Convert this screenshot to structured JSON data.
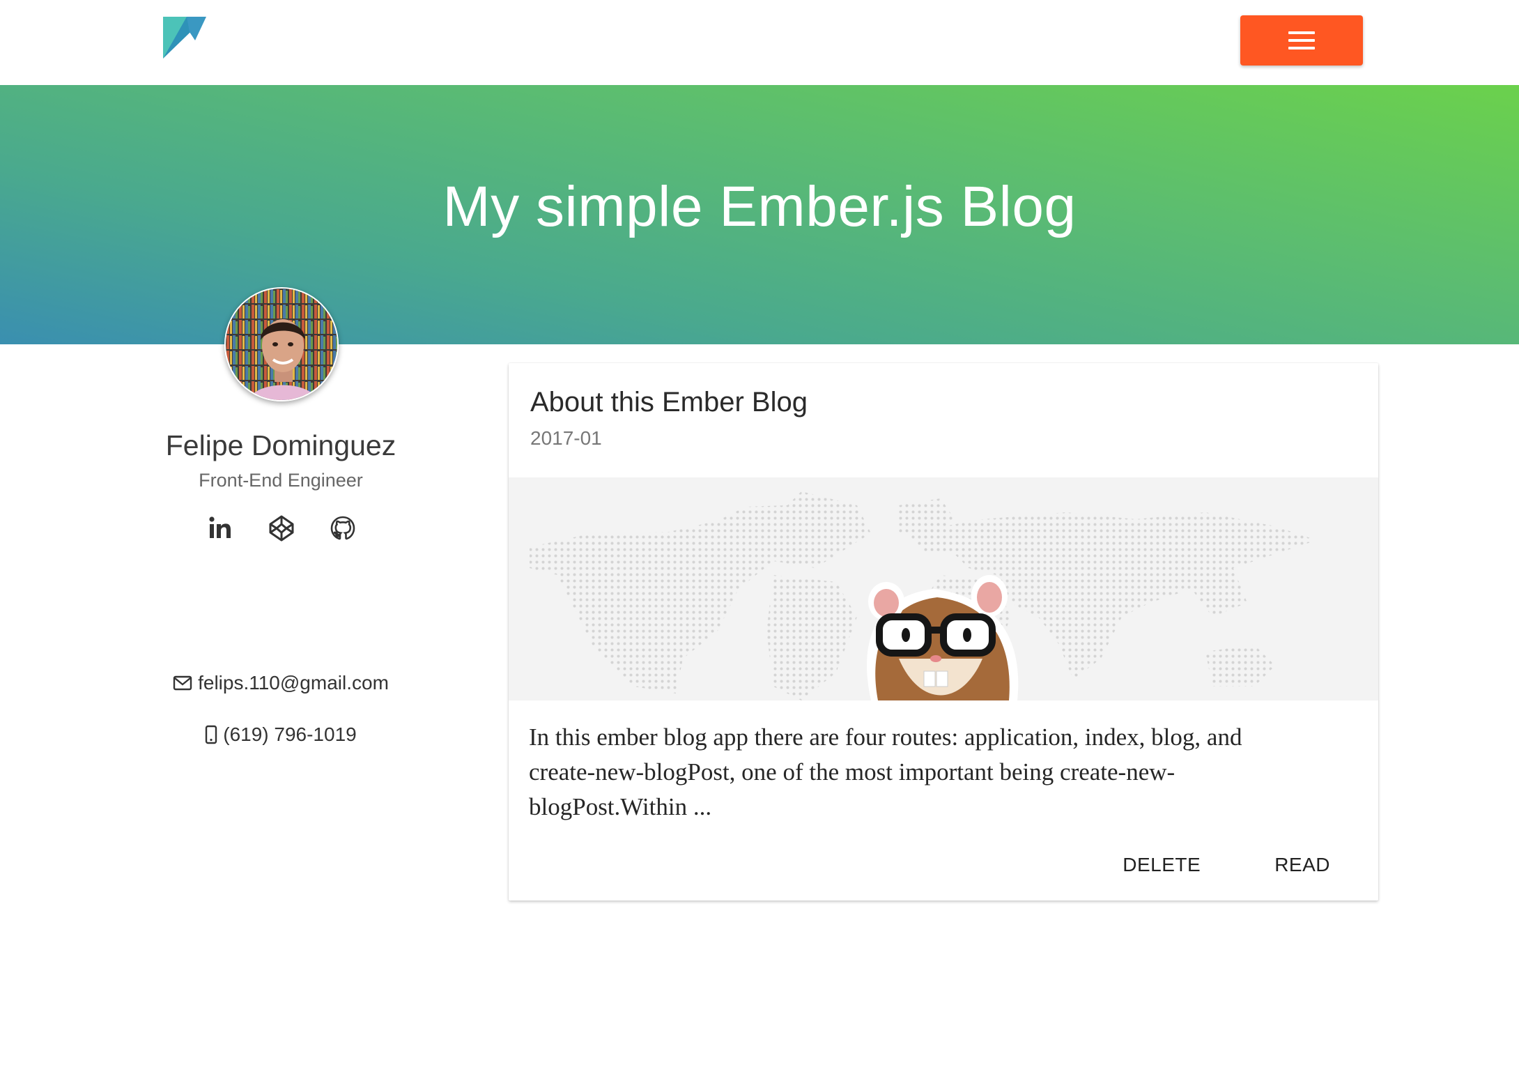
{
  "header": {
    "logo_icon": "triangle-logo-icon",
    "menu_icon": "hamburger-menu-icon",
    "menu_color": "#ff5722"
  },
  "hero": {
    "title": "My simple Ember.js Blog",
    "gradient_colors": [
      "#3a8fb0",
      "#5cbd70",
      "#6bd14c"
    ]
  },
  "profile": {
    "name": "Felipe Dominguez",
    "title": "Front-End Engineer",
    "social": [
      {
        "icon": "linkedin-icon"
      },
      {
        "icon": "codepen-icon"
      },
      {
        "icon": "github-icon"
      }
    ],
    "email": "felips.110@gmail.com",
    "phone": "(619) 796-1019"
  },
  "post": {
    "title": "About this Ember Blog",
    "date": "2017-01",
    "excerpt": "In this ember blog app there are four routes: application, index, blog, and create-new-blogPost, one of the most important being create-new-blogPost.Within ...",
    "actions": {
      "delete_label": "DELETE",
      "read_label": "READ"
    },
    "image_icon": "ember-hamster-mascot"
  }
}
